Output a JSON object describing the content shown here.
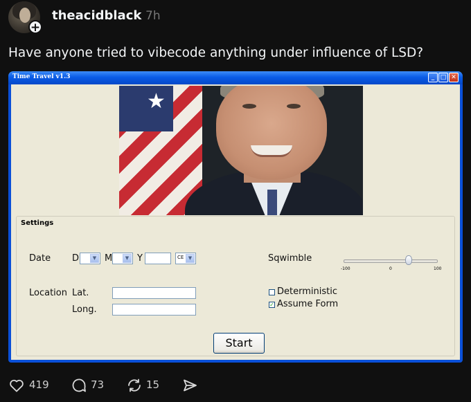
{
  "post": {
    "username": "theacidblack",
    "time": "7h",
    "text": "Have anyone tried to vibecode anything under influence of LSD?"
  },
  "window": {
    "title": "Time Travel v1.3",
    "controls": {
      "minimize": "_",
      "maximize": "□",
      "close": "✕"
    },
    "image_alt": "Portrait photo of a smiling man in a suit in front of an American flag",
    "settings": {
      "legend": "Settings",
      "date_label": "Date",
      "d_label": "D",
      "m_label": "M",
      "y_label": "Y",
      "d_value": "",
      "m_value": "",
      "y_value": "",
      "era_value": "CE",
      "location_label": "Location",
      "lat_label": "Lat.",
      "long_label": "Long.",
      "lat_value": "",
      "long_value": "",
      "sqwimble_label": "Sqwimble",
      "slider": {
        "min": "-100",
        "mid": "0",
        "max": "100",
        "value": 40
      },
      "deterministic_label": "Deterministic",
      "deterministic_checked": false,
      "assume_form_label": "Assume Form",
      "assume_form_checked": true,
      "start_label": "Start"
    }
  },
  "actions": {
    "likes": "419",
    "replies": "73",
    "reposts": "15"
  }
}
